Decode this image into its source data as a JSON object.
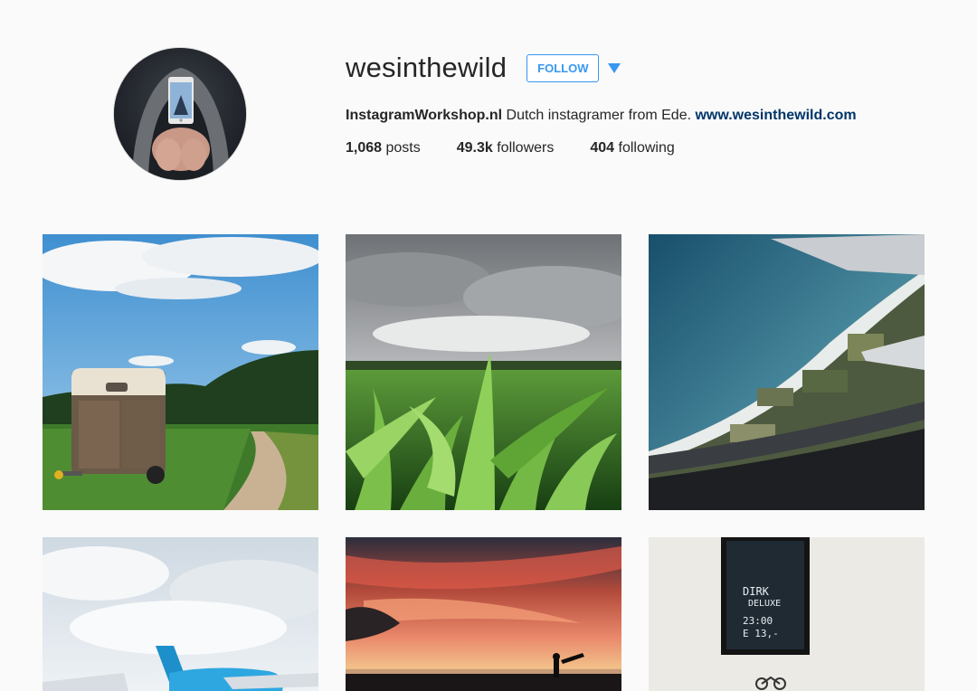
{
  "profile": {
    "username": "wesinthewild",
    "follow_label": "FOLLOW",
    "bio_name": "InstagramWorkshop.nl",
    "bio_text": " Dutch instagramer from Ede. ",
    "bio_link": "www.wesinthewild.com",
    "stats": {
      "posts_count": "1,068",
      "posts_label": " posts",
      "followers_count": "49.3k",
      "followers_label": " followers",
      "following_count": "404",
      "following_label": " following"
    }
  },
  "posts": [
    {
      "subject": "horse-trailer-on-country-road"
    },
    {
      "subject": "corn-field-under-cloudy-sky"
    },
    {
      "subject": "aerial-coastline-from-plane-window"
    },
    {
      "subject": "klm-airplane-in-clouds"
    },
    {
      "subject": "surfer-at-sunset-beach"
    },
    {
      "subject": "dirk-deluxe-chalkboard-sign"
    }
  ],
  "sign_text": {
    "line1": "DIRK",
    "line2": "DELUXE",
    "line3": "23:00",
    "line4": "E 13,-"
  },
  "colors": {
    "accent": "#3897f0",
    "link": "#003569",
    "background": "#fafafa"
  }
}
